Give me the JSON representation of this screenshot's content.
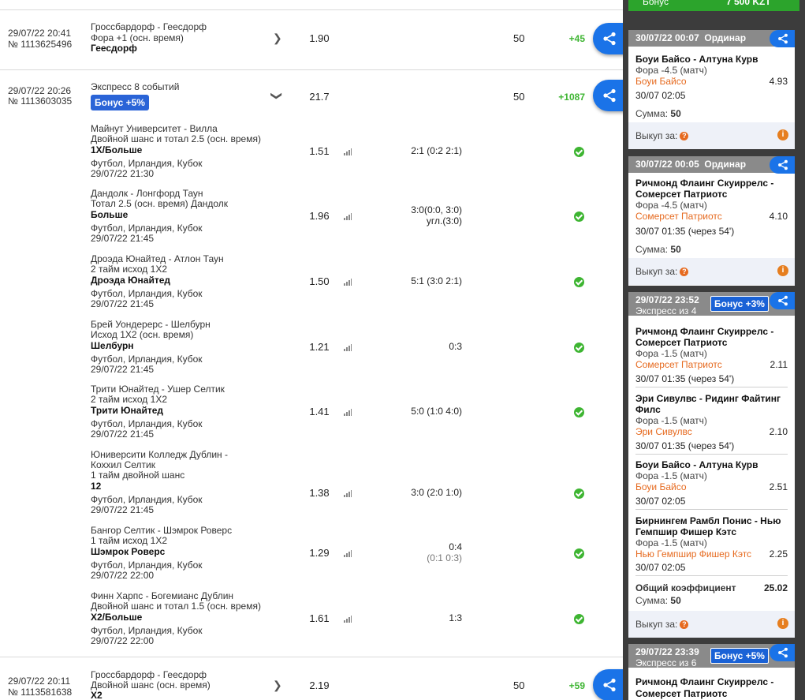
{
  "share_icon": "share-icon",
  "bets": [
    {
      "date": "29/07/22 20:41",
      "num": "№ 1113625496",
      "match": "Гроссбардорф - Геесдорф",
      "market": "Фора +1 (осн. время)",
      "pick": "Геесдорф",
      "odds": "1.90",
      "stake": "50",
      "win": "+45"
    },
    {
      "date": "29/07/22 20:26",
      "num": "№ 1113603035",
      "title": "Экспресс 8 событий",
      "bonus": "Бонус +5%",
      "odds": "21.7",
      "stake": "50",
      "win": "+1087"
    },
    {
      "date": "29/07/22 20:11",
      "num": "№ 1113581638",
      "match": "Гроссбардорф - Геесдорф",
      "market": "Двойной шанс (осн. время)",
      "pick": "X2",
      "odds": "2.19",
      "stake": "50",
      "win": "+59"
    }
  ],
  "events": [
    {
      "l1": "Майнут Университет - Вилла",
      "l2": "Двойной шанс и тотал 2.5 (осн. время)",
      "pick": "1X/Больше",
      "league": "Футбол, Ирландия, Кубок",
      "time": "29/07/22 21:30",
      "odds": "1.51",
      "score": "2:1 (0:2 2:1)"
    },
    {
      "l1": "Дандолк - Лонгфорд Таун",
      "l2": "Тотал 2.5 (осн. время) Дандолк",
      "pick": "Больше",
      "league": "Футбол, Ирландия, Кубок",
      "time": "29/07/22 21:45",
      "odds": "1.96",
      "score": "3:0(0:0, 3:0)",
      "score2": "угл.(3:0)"
    },
    {
      "l1": "Дроэда Юнайтед - Атлон Таун",
      "l2": "2 тайм исход 1X2",
      "pick": "Дроэда Юнайтед",
      "league": "Футбол, Ирландия, Кубок",
      "time": "29/07/22 21:45",
      "odds": "1.50",
      "score": "5:1 (3:0 2:1)"
    },
    {
      "l1": "Брей Уондерерс - Шелбурн",
      "l2": "Исход 1X2 (осн. время)",
      "pick": "Шелбурн",
      "league": "Футбол, Ирландия, Кубок",
      "time": "29/07/22 21:45",
      "odds": "1.21",
      "score": "0:3"
    },
    {
      "l1": "Трити Юнайтед - Ушер Селтик",
      "l2": "2 тайм исход 1X2",
      "pick": "Трити Юнайтед",
      "league": "Футбол, Ирландия, Кубок",
      "time": "29/07/22 21:45",
      "odds": "1.41",
      "score": "5:0 (1:0 4:0)"
    },
    {
      "l1": "Юниверсити Колледж Дублин -",
      "l1b": "Коххил Селтик",
      "l2": "1 тайм двойной шанс",
      "pick": "12",
      "league": "Футбол, Ирландия, Кубок",
      "time": "29/07/22 21:45",
      "odds": "1.38",
      "score": "3:0 (2:0 1:0)"
    },
    {
      "l1": "Бангор Селтик - Шэмрок Роверс",
      "l2": "1 тайм исход 1X2",
      "pick": "Шэмрок Роверс",
      "league": "Футбол, Ирландия, Кубок",
      "time": "29/07/22 22:00",
      "odds": "1.29",
      "score": "0:4",
      "score2": "(0:1 0:3)"
    },
    {
      "l1": "Финн Харпс - Богемианс Дублин",
      "l2": "Двойной шанс и тотал 1.5 (осн. время)",
      "pick": "X2/Больше",
      "league": "Футбол, Ирландия, Кубок",
      "time": "29/07/22 22:00",
      "odds": "1.61",
      "score": "1:3"
    }
  ],
  "sidebar": {
    "top_left": "Бонус",
    "top_right": "7 500 KZT",
    "cards": [
      {
        "head": "30/07/22 00:07",
        "type": "Ординар",
        "teams": "Боуи Байсо - Алтуна Курв",
        "market": "Фора -4.5 (матч)",
        "pick": "Боуи Байсо",
        "odds": "4.93",
        "date": "30/07 02:05",
        "sum_label": "Сумма:",
        "sum": "50",
        "cashout": "Выкуп за:"
      },
      {
        "head": "30/07/22 00:05",
        "type": "Ординар",
        "teams1": "Ричмонд Флаинг Скуиррелс -",
        "teams2": "Сомерсет Патриотс",
        "market": "Фора -4.5 (матч)",
        "pick": "Сомерсет Патриотс",
        "odds": "4.10",
        "date": "30/07 01:35 (через 54')",
        "sum_label": "Сумма:",
        "sum": "50",
        "cashout": "Выкуп за:"
      },
      {
        "head": "29/07/22 23:52",
        "sub": "Экспресс из 4",
        "bonus": "Бонус +3%",
        "legs": [
          {
            "t1": "Ричмонд Флаинг Скуиррелс -",
            "t2": "Сомерсет Патриотс",
            "market": "Фора -1.5 (матч)",
            "pick": "Сомерсет Патриотс",
            "odds": "2.11",
            "date": "30/07 01:35 (через 54')"
          },
          {
            "t1": "Эри Сивулвс - Ридинг Файтинг",
            "t2": "Филс",
            "market": "Фора -1.5 (матч)",
            "pick": "Эри Сивулвс",
            "odds": "2.10",
            "date": "30/07 01:35 (через 54')"
          },
          {
            "t1": "Боуи Байсо - Алтуна Курв",
            "market": "Фора -1.5 (матч)",
            "pick": "Боуи Байсо",
            "odds": "2.51",
            "date": "30/07 02:05"
          },
          {
            "t1": "Бирнингем Рамбл Понис - Нью",
            "t2": "Гемпшир Фишер Кэтс",
            "market": "Фора -1.5 (матч)",
            "pick": "Нью Гемпшир Фишер Кэтс",
            "odds": "2.25",
            "date": "30/07 02:05"
          }
        ],
        "total_label": "Общий коэффициент",
        "total": "25.02",
        "sum_label": "Сумма:",
        "sum": "50",
        "cashout": "Выкуп за:"
      },
      {
        "head": "29/07/22 23:39",
        "sub": "Экспресс из 6",
        "bonus": "Бонус +5%",
        "t1": "Ричмонд Флаинг Скуиррелс -",
        "t2": "Сомерсет Патриотс"
      }
    ]
  }
}
